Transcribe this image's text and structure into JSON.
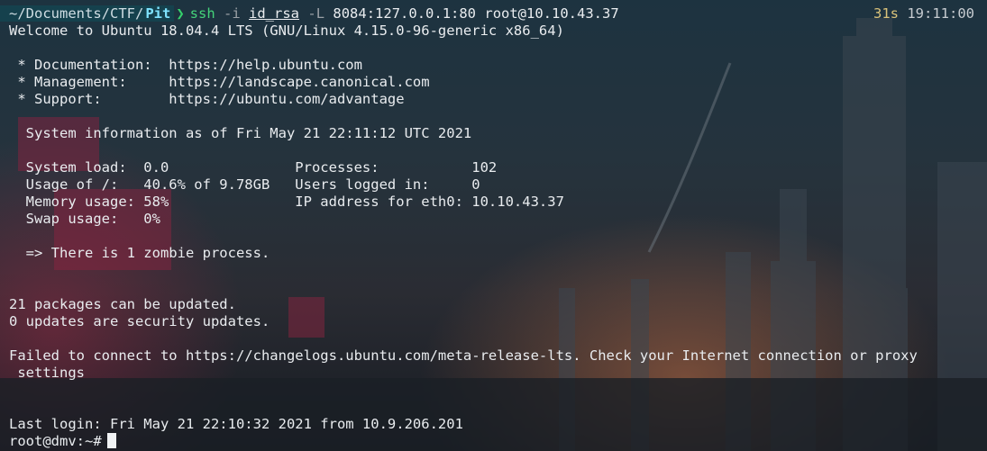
{
  "prompt": {
    "path": "~/Documents/CTF/",
    "dir": "Pit",
    "chevron": "❯",
    "cmd": "ssh",
    "flag1": "-i",
    "keyfile": "id_rsa",
    "flag2": "-L",
    "forward": "8084:127.0.0.1:80",
    "target": "root@10.10.43.37"
  },
  "right_prompt": {
    "duration": "31s",
    "clock": "19:11:00"
  },
  "lines": [
    "Welcome to Ubuntu 18.04.4 LTS (GNU/Linux 4.15.0-96-generic x86_64)",
    "",
    " * Documentation:  https://help.ubuntu.com",
    " * Management:     https://landscape.canonical.com",
    " * Support:        https://ubuntu.com/advantage",
    "",
    "  System information as of Fri May 21 22:11:12 UTC 2021",
    "",
    "  System load:  0.0               Processes:           102",
    "  Usage of /:   40.6% of 9.78GB   Users logged in:     0",
    "  Memory usage: 58%               IP address for eth0: 10.10.43.37",
    "  Swap usage:   0%",
    "",
    "  => There is 1 zombie process.",
    "",
    "",
    "21 packages can be updated.",
    "0 updates are security updates.",
    "",
    "Failed to connect to https://changelogs.ubuntu.com/meta-release-lts. Check your Internet connection or proxy",
    " settings",
    "",
    "",
    "Last login: Fri May 21 22:10:32 2021 from 10.9.206.201"
  ],
  "shell_prompt": "root@dmv:~#",
  "colors": {
    "accent_green": "#35d16b",
    "path_bg": "#15414d",
    "dir_fg": "#7fe3ff",
    "clock_fg": "#d9c27a"
  }
}
